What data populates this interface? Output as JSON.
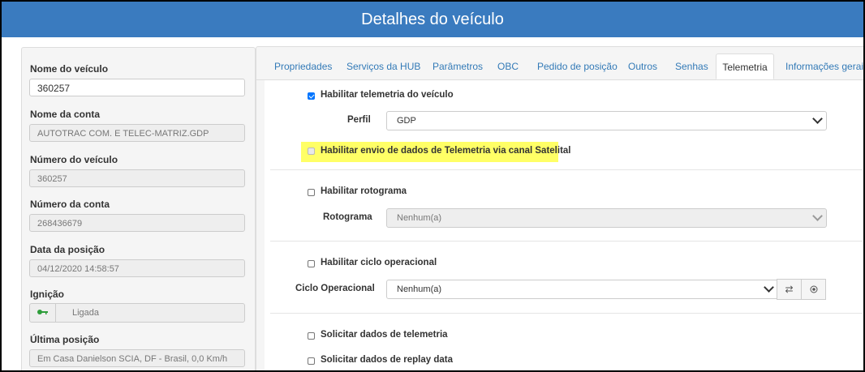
{
  "header": {
    "title": "Detalhes do veículo"
  },
  "left": {
    "nome_veiculo": {
      "label": "Nome do veículo",
      "value": "360257"
    },
    "nome_conta": {
      "label": "Nome da conta",
      "value": "AUTOTRAC COM. E TELEC-MATRIZ.GDP"
    },
    "numero_veiculo": {
      "label": "Número do veículo",
      "value": "360257"
    },
    "numero_conta": {
      "label": "Número da conta",
      "value": "268436679"
    },
    "data_posicao": {
      "label": "Data da posição",
      "value": "04/12/2020 14:58:57"
    },
    "ignicao": {
      "label": "Ignição",
      "value": "Ligada",
      "icon": "key-icon",
      "icon_color": "#2e9d3a"
    },
    "ultima_posicao": {
      "label": "Última posição",
      "value": "Em  Casa Danielson SCIA, DF - Brasil, 0,0 Km/h"
    }
  },
  "tabs": [
    "Propriedades",
    "Serviços da HUB",
    "Parâmetros",
    "OBC",
    "Pedido de posição",
    "Outros",
    "Senhas",
    "Telemetria",
    "Informações gerais"
  ],
  "active_tab": "Telemetria",
  "telemetria": {
    "habilitar_telemetria": {
      "label": "Habilitar telemetria do veículo",
      "checked": true
    },
    "perfil": {
      "label": "Perfil",
      "value": "GDP"
    },
    "envio_satelital": {
      "label": "Habilitar envio de dados de Telemetria via canal Satelital",
      "checked": false,
      "disabled": true,
      "highlight_color": "#ffff66"
    },
    "habilitar_rotograma": {
      "label": "Habilitar rotograma",
      "checked": false
    },
    "rotograma": {
      "label": "Rotograma",
      "value": "Nenhum(a)"
    },
    "habilitar_ciclo": {
      "label": "Habilitar ciclo operacional",
      "checked": false
    },
    "ciclo": {
      "label": "Ciclo Operacional",
      "value": "Nenhum(a)"
    },
    "solicitar_telemetria": {
      "label": "Solicitar dados de telemetria",
      "checked": false
    },
    "solicitar_replay": {
      "label": "Solicitar dados de replay data",
      "checked": false
    }
  },
  "colors": {
    "header": "#3a7bbf",
    "link": "#337ab7",
    "checkbox": "#0075ff"
  }
}
